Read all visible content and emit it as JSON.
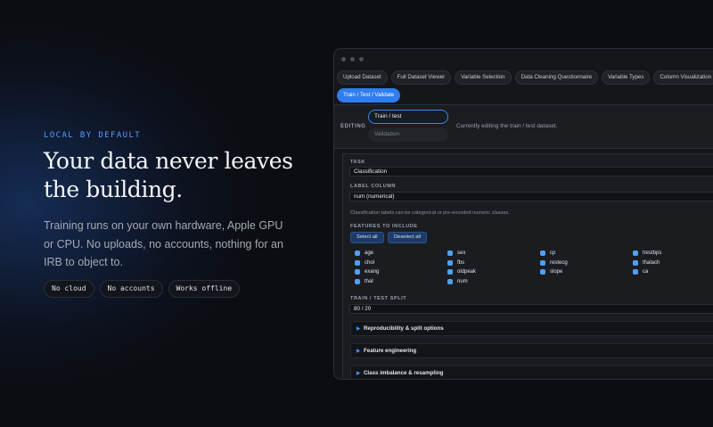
{
  "hero": {
    "eyebrow": "LOCAL BY DEFAULT",
    "headline": "Your data never leaves the building.",
    "lede": "Training runs on your own hardware, Apple GPU or CPU. No uploads, no accounts, nothing for an IRB to object to.",
    "pills": [
      "No cloud",
      "No accounts",
      "Works offline"
    ]
  },
  "app": {
    "tabs": [
      "Upload Dataset",
      "Full Dataset Viewer",
      "Variable Selection",
      "Data Cleaning Questionnaire",
      "Variable Types",
      "Column Visualization",
      "Train / Test / Validate"
    ],
    "active_tab": "Train / Test / Validate",
    "editing": {
      "label": "EDITING",
      "options": [
        "Train / test",
        "Validation"
      ],
      "selected": "Train / test",
      "note": "Currently editing the train / test dataset."
    },
    "task": {
      "label": "TASK",
      "value": "Classification"
    },
    "label_column": {
      "label": "LABEL COLUMN",
      "value": "num (numerical)",
      "hint": "Classification labels can be categorical or pre-encoded numeric classes."
    },
    "features": {
      "label": "FEATURES TO INCLUDE",
      "select_all": "Select all",
      "deselect_all": "Deselect all",
      "items": [
        "age",
        "sex",
        "cp",
        "trestbps",
        "chol",
        "fbs",
        "restecg",
        "thalach",
        "exang",
        "oldpeak",
        "slope",
        "ca",
        "thal",
        "num"
      ]
    },
    "split": {
      "label": "TRAIN / TEST SPLIT",
      "value": "80 / 20"
    },
    "sections": [
      "Reproducibility & split options",
      "Feature engineering",
      "Class imbalance & resampling"
    ]
  },
  "colors": {
    "accent": "#2f7ef0",
    "eyebrow": "#5b9cf5",
    "check": "#4fa0f7",
    "background": "#0b0d12"
  }
}
